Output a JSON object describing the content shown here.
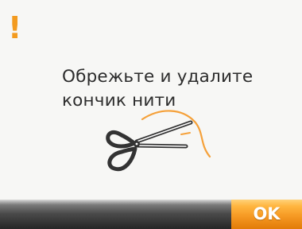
{
  "dialog": {
    "warning_symbol": "!",
    "message_lines": [
      "Обрежьте и удалите",
      "кончик нити"
    ],
    "illustration_icon": "scissors-cutting-thread-icon",
    "ok_label": "OK"
  },
  "colors": {
    "accent": "#f39b1f",
    "background": "#f7f7f5",
    "bottom_bar": "#262626",
    "thread": "#f5a13a"
  }
}
